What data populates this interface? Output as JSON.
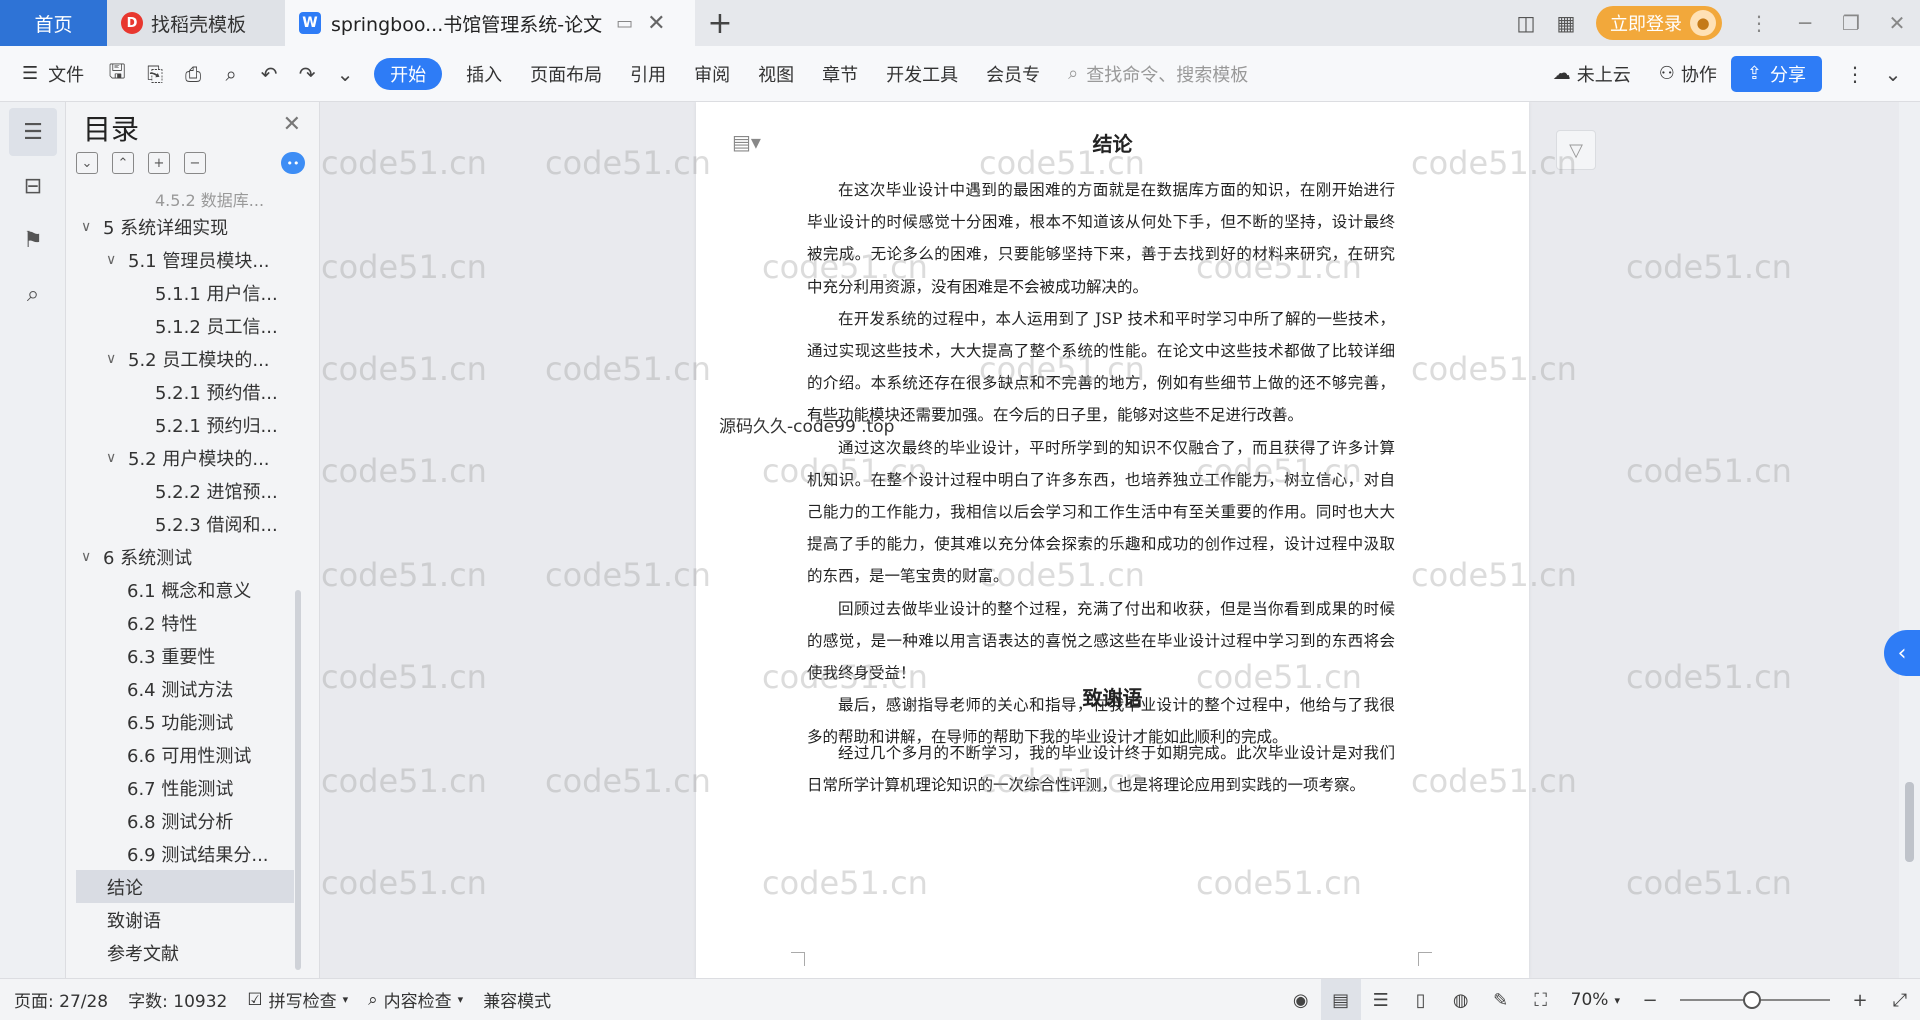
{
  "titlebar": {
    "tabs": [
      {
        "label": "首页"
      },
      {
        "label": "找稻壳模板"
      },
      {
        "label": "springboo...书馆管理系统-论文"
      }
    ],
    "add_tab": "+",
    "login_label": "立即登录"
  },
  "ribbon": {
    "file_label": "文件",
    "menu": [
      "开始",
      "插入",
      "页面布局",
      "引用",
      "审阅",
      "视图",
      "章节",
      "开发工具",
      "会员专"
    ],
    "search_placeholder": "查找命令、搜索模板",
    "cloud_label": "未上云",
    "collab_label": "协作",
    "share_label": "分享"
  },
  "toc": {
    "title": "目录",
    "items": [
      {
        "label": "4.5.2 数据库..."
      },
      {
        "label": "5 系统详细实现"
      },
      {
        "label": "5.1  管理员模块..."
      },
      {
        "label": "5.1.1  用户信..."
      },
      {
        "label": "5.1.2  员工信..."
      },
      {
        "label": "5.2  员工模块的..."
      },
      {
        "label": "5.2.1  预约借..."
      },
      {
        "label": "5.2.1  预约归..."
      },
      {
        "label": "5.2  用户模块的..."
      },
      {
        "label": "5.2.2  进馆预..."
      },
      {
        "label": "5.2.3  借阅和..."
      },
      {
        "label": "6 系统测试"
      },
      {
        "label": "6.1 概念和意义"
      },
      {
        "label": "6.2 特性"
      },
      {
        "label": "6.3 重要性"
      },
      {
        "label": "6.4 测试方法"
      },
      {
        "label": "6.5  功能测试"
      },
      {
        "label": "6.6 可用性测试"
      },
      {
        "label": "6.7 性能测试"
      },
      {
        "label": "6.8 测试分析"
      },
      {
        "label": "6.9 测试结果分..."
      },
      {
        "label": "结论"
      },
      {
        "label": "致谢语"
      },
      {
        "label": "参考文献"
      }
    ]
  },
  "document": {
    "heading1": "结论",
    "paragraphs1": [
      "在这次毕业设计中遇到的最困难的方面就是在数据库方面的知识，在刚开始进行毕业设计的时候感觉十分困难，根本不知道该从何处下手，但不断的坚持，设计最终被完成。无论多么的困难，只要能够坚持下来，善于去找到好的材料来研究，在研究中充分利用资源，没有困难是不会被成功解决的。",
      "在开发系统的过程中，本人运用到了 JSP 技术和平时学习中所了解的一些技术，通过实现这些技术，大大提高了整个系统的性能。在论文中这些技术都做了比较详细的介绍。本系统还存在很多缺点和不完善的地方，例如有些细节上做的还不够完善，有些功能模块还需要加强。在今后的日子里，能够对这些不足进行改善。",
      "通过这次最终的毕业设计，平时所学到的知识不仅融合了，而且获得了许多计算机知识。在整个设计过程中明白了许多东西，也培养独立工作能力，树立信心，对自己能力的工作能力，我相信以后会学习和工作生活中有至关重要的作用。同时也大大提高了手的能力，使其难以充分体会探索的乐趣和成功的创作过程，设计过程中汲取的东西，是一笔宝贵的财富。",
      "回顾过去做毕业设计的整个过程，充满了付出和收获，但是当你看到成果的时候的感觉，是一种难以用言语表达的喜悦之感这些在毕业设计过程中学习到的东西将会使我终身受益！",
      "最后，感谢指导老师的关心和指导，在我毕业设计的整个过程中，他给与了我很多的帮助和讲解，在导师的帮助下我的毕业设计才能如此顺利的完成。"
    ],
    "heading2": "致谢语",
    "paragraphs2": [
      "经过几个多月的不断学习，我的毕业设计终于如期完成。此次毕业设计是对我们日常所学计算机理论知识的一次综合性评测，也是将理论应用到实践的一项考察。"
    ],
    "overlay_text": "源码久久-code99 .top",
    "watermark": "code51.cn"
  },
  "statusbar": {
    "page": "页面: 27/28",
    "words": "字数: 10932",
    "spell": "拼写检查",
    "content_check": "内容检查",
    "compat": "兼容模式",
    "zoom": "70%"
  }
}
